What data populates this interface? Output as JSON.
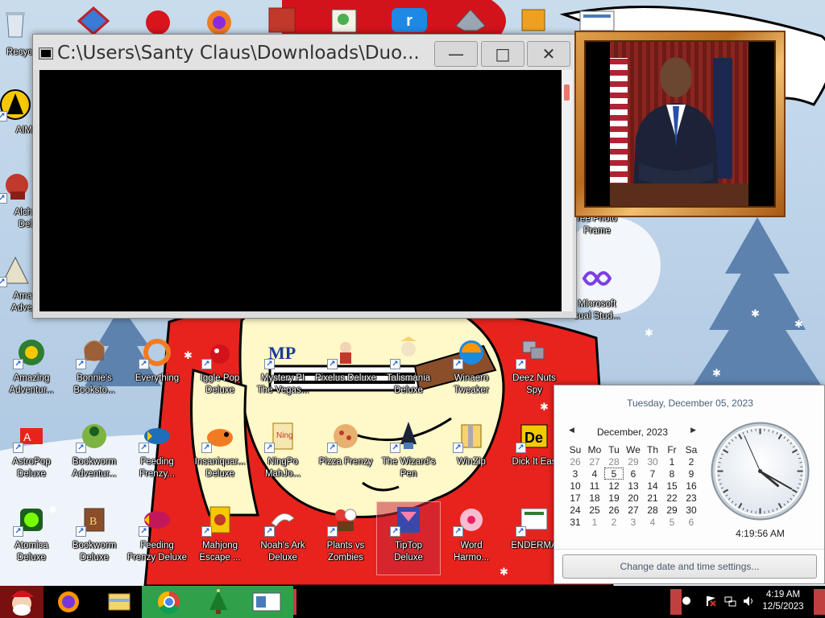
{
  "desktop": {
    "partial_labels": {
      "recycle": "Recyc",
      "aim": "AIM",
      "alch": "Alch\nDel",
      "ama": "Ama\nAdve"
    },
    "icons": [
      {
        "label": "Amazing\nAdventur..."
      },
      {
        "label": "Bonnie's\nBooksto..."
      },
      {
        "label": "Everything"
      },
      {
        "label": "Iggle Pop\nDeluxe"
      },
      {
        "label": "Mystery PI\nThe Vegas..."
      },
      {
        "label": "Pixelus Deluxe"
      },
      {
        "label": "Talismania\nDeluxe"
      },
      {
        "label": "Winaero\nTweaker"
      },
      {
        "label": "Deez Nuts\nSpy"
      },
      {
        "label": "AstroPop\nDeluxe"
      },
      {
        "label": "Bookworm\nAdventur..."
      },
      {
        "label": "Feeding\nFrenzy..."
      },
      {
        "label": "Insaniquar...\nDeluxe"
      },
      {
        "label": "NingPo\nMahJo..."
      },
      {
        "label": "Pizza Frenzy"
      },
      {
        "label": "The Wizard's\nPen"
      },
      {
        "label": "WinZip"
      },
      {
        "label": "Dick It Eas"
      },
      {
        "label": "Atomica\nDeluxe"
      },
      {
        "label": "Bookworm\nDeluxe"
      },
      {
        "label": "Feeding\nFrenzy Deluxe"
      },
      {
        "label": "Mahjong\nEscape ..."
      },
      {
        "label": "Noah's Ark\nDeluxe"
      },
      {
        "label": "Plants vs\nZombies"
      },
      {
        "label": "TipTop\nDeluxe"
      },
      {
        "label": "Word\nHarmo..."
      },
      {
        "label": "ENDERMA"
      },
      {
        "label": "ree Photo\nFrame"
      },
      {
        "label": "Microsoft\nsual Stud..."
      }
    ]
  },
  "console_window": {
    "title": "C:\\Users\\Santy Claus\\Downloads\\Duo...",
    "minimize": "—",
    "maximize": "□",
    "close": "✕"
  },
  "clock_flyout": {
    "long_date": "Tuesday, December 05, 2023",
    "month_title": "December, 2023",
    "prev": "◀",
    "next": "▶",
    "weekdays": [
      "Su",
      "Mo",
      "Tu",
      "We",
      "Th",
      "Fr",
      "Sa"
    ],
    "weeks": [
      [
        "26",
        "27",
        "28",
        "29",
        "30",
        "1",
        "2"
      ],
      [
        "3",
        "4",
        "5",
        "6",
        "7",
        "8",
        "9"
      ],
      [
        "10",
        "11",
        "12",
        "13",
        "14",
        "15",
        "16"
      ],
      [
        "17",
        "18",
        "19",
        "20",
        "21",
        "22",
        "23"
      ],
      [
        "24",
        "25",
        "26",
        "27",
        "28",
        "29",
        "30"
      ],
      [
        "31",
        "1",
        "2",
        "3",
        "4",
        "5",
        "6"
      ]
    ],
    "today": "5",
    "digital_time": "4:19:56 AM",
    "clock": {
      "hour": 4,
      "minute": 19,
      "second": 56
    },
    "change_settings": "Change date and time settings..."
  },
  "taskbar": {
    "time": "4:19 AM",
    "date": "12/5/2023"
  },
  "colors": {
    "taskbar": "#000000",
    "accent_green": "#2fa14a",
    "console_bg": "#000000"
  }
}
